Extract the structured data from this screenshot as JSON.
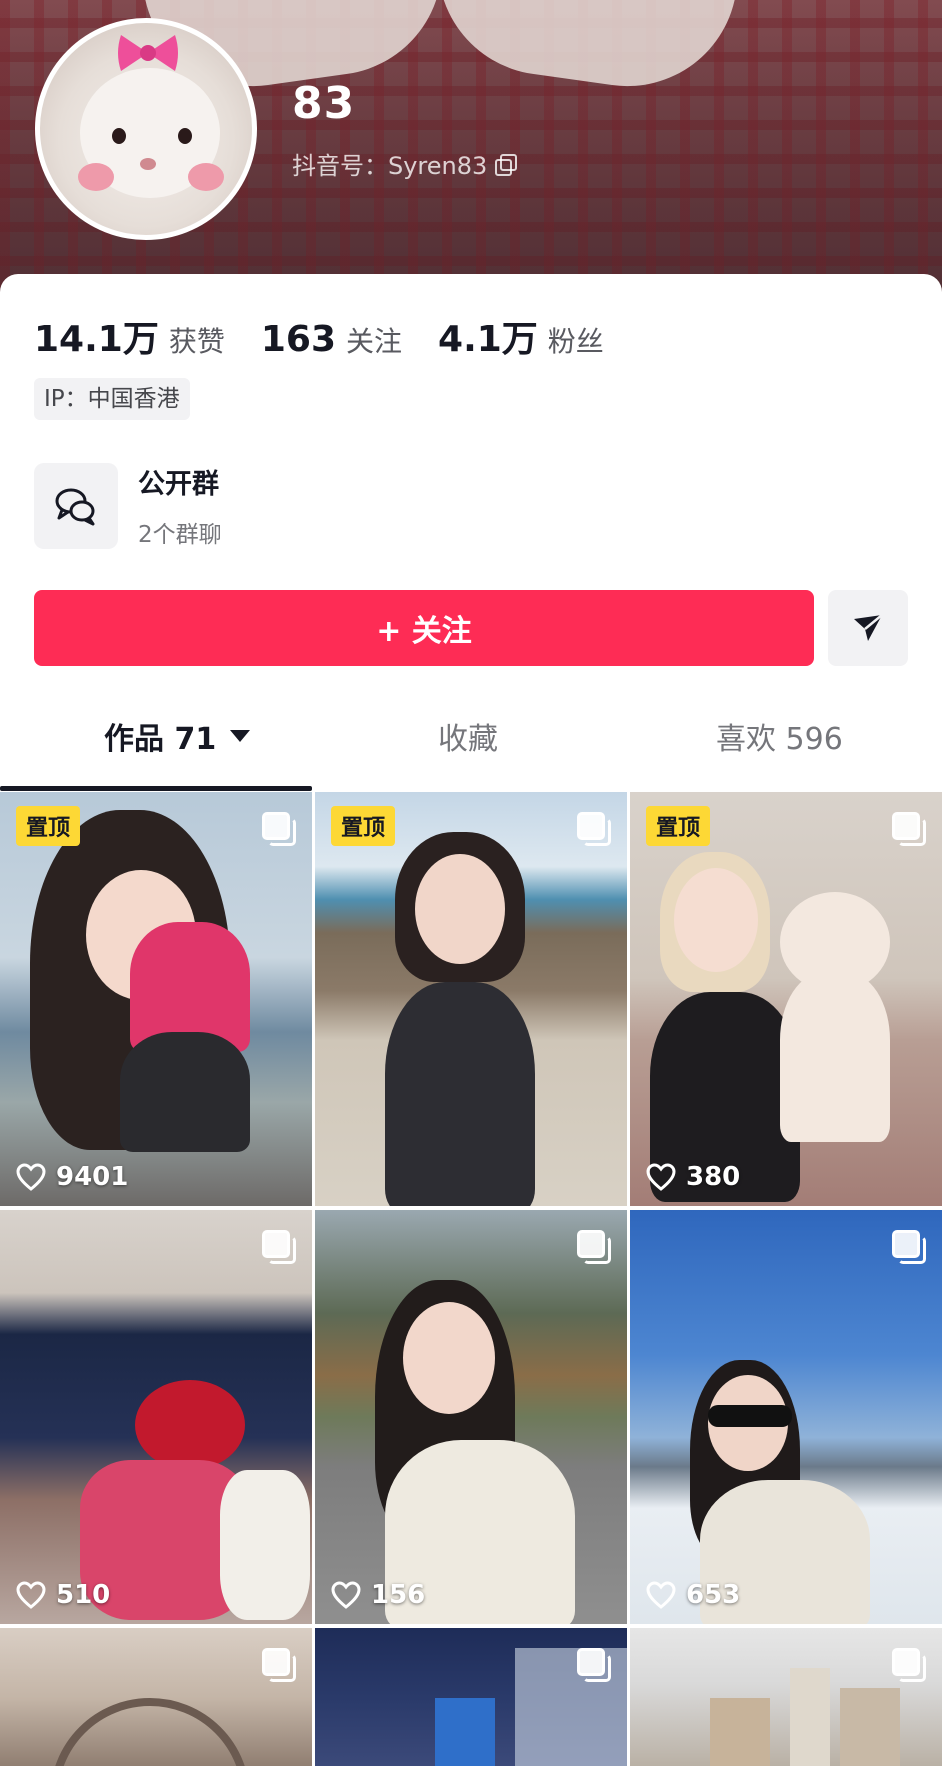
{
  "profile": {
    "name": "83",
    "douyin_id": "抖音号：Syren83",
    "avatar_icon": "hamster-avatar"
  },
  "stats": [
    {
      "num": "14.1万",
      "label": "获赞"
    },
    {
      "num": "163",
      "label": "关注"
    },
    {
      "num": "4.1万",
      "label": "粉丝"
    }
  ],
  "ip": "IP：中国香港",
  "group": {
    "title": "公开群",
    "subtitle": "2个群聊",
    "icon": "chat-bubbles-icon"
  },
  "actions": {
    "follow_label": "+ 关注",
    "share_icon": "send-icon"
  },
  "tabs": [
    {
      "label": "作品 71",
      "active": true
    },
    {
      "label": "收藏",
      "active": false
    },
    {
      "label": "喜欢 596",
      "active": false
    }
  ],
  "pin_label": "置顶",
  "videos": [
    {
      "pinned": true,
      "likes": "9401"
    },
    {
      "pinned": true,
      "likes": ""
    },
    {
      "pinned": true,
      "likes": "380"
    },
    {
      "pinned": false,
      "likes": "510"
    },
    {
      "pinned": false,
      "likes": "156"
    },
    {
      "pinned": false,
      "likes": "653"
    },
    {
      "pinned": false,
      "likes": ""
    },
    {
      "pinned": false,
      "likes": ""
    },
    {
      "pinned": false,
      "likes": ""
    }
  ],
  "colors": {
    "accent": "#fe2c55",
    "pin_badge": "#fdd835",
    "text_primary": "#161823"
  }
}
